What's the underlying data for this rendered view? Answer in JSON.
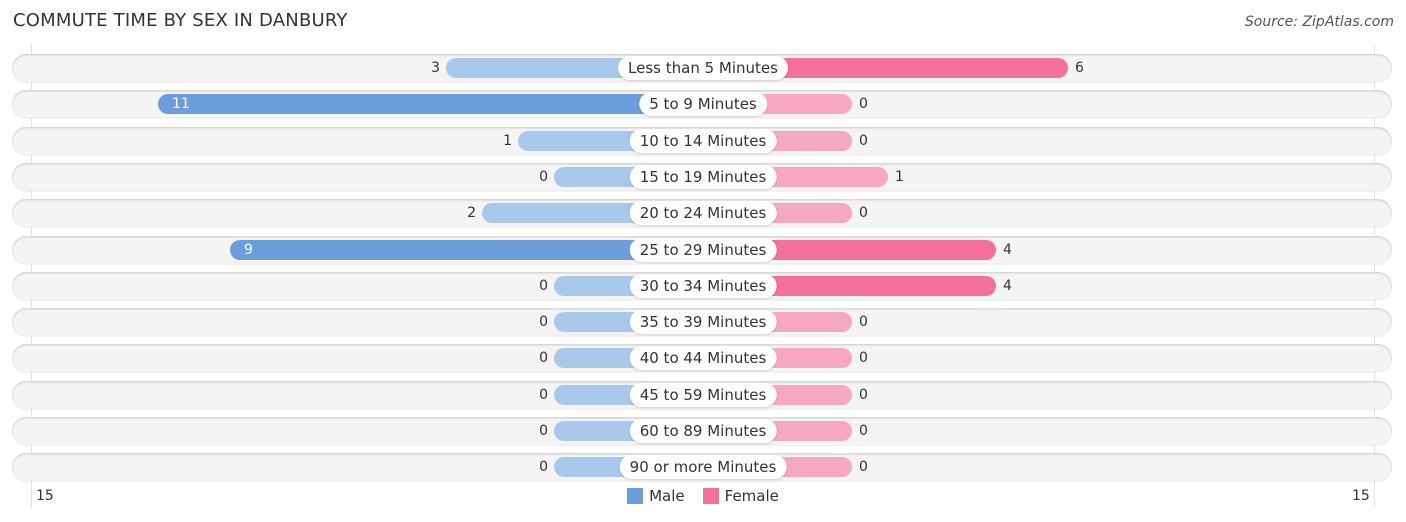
{
  "header": {
    "title": "COMMUTE TIME BY SEX IN DANBURY",
    "source": "Source: ZipAtlas.com"
  },
  "colors": {
    "male_strong": "#6a9fdb",
    "male_light": "#a8c8ec",
    "female_strong": "#f2709a",
    "female_light": "#f6a8c1"
  },
  "chart_data": {
    "type": "bar",
    "orientation": "horizontal-diverging",
    "title": "COMMUTE TIME BY SEX IN DANBURY",
    "categories": [
      "Less than 5 Minutes",
      "5 to 9 Minutes",
      "10 to 14 Minutes",
      "15 to 19 Minutes",
      "20 to 24 Minutes",
      "25 to 29 Minutes",
      "30 to 34 Minutes",
      "35 to 39 Minutes",
      "40 to 44 Minutes",
      "45 to 59 Minutes",
      "60 to 89 Minutes",
      "90 or more Minutes"
    ],
    "series": [
      {
        "name": "Male",
        "values": [
          3,
          11,
          1,
          0,
          2,
          9,
          0,
          0,
          0,
          0,
          0,
          0
        ]
      },
      {
        "name": "Female",
        "values": [
          6,
          0,
          0,
          1,
          0,
          4,
          4,
          0,
          0,
          0,
          0,
          0
        ]
      }
    ],
    "axis": {
      "left_label": "15",
      "right_label": "15",
      "range": [
        0,
        15
      ]
    },
    "legend": {
      "position": "bottom-center",
      "entries": [
        "Male",
        "Female"
      ]
    },
    "grid": false
  }
}
